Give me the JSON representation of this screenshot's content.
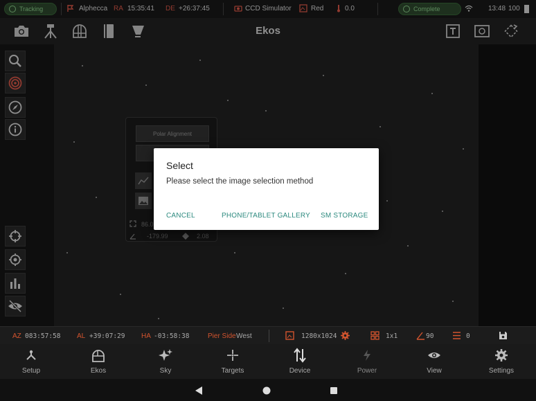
{
  "status_bar": {
    "tracking_label": "Tracking",
    "target_name": "Alphecca",
    "ra_label": "RA",
    "ra_value": "15:35:41",
    "de_label": "DE",
    "de_value": "+26:37:45",
    "camera_name": "CCD Simulator",
    "filter_name": "Red",
    "temperature": "0.0",
    "capture_status": "Complete",
    "clock": "13:48",
    "battery": "100"
  },
  "toolbar": {
    "title": "Ekos"
  },
  "polar_panel": {
    "button_label": "Polar Alignment",
    "value1": "86.0",
    "value2": "-179.99",
    "value3": "2.08"
  },
  "dialog": {
    "title": "Select",
    "message": "Please select the image selection method",
    "cancel_label": "CANCEL",
    "gallery_label": "PHONE/TABLET GALLERY",
    "storage_label": "SM STORAGE"
  },
  "info_bar": {
    "az_label": "AZ",
    "az_value": "083:57:58",
    "al_label": "AL",
    "al_value": "+39:07:29",
    "ha_label": "HA",
    "ha_value": "-03:58:38",
    "pier_label": "Pier Side",
    "pier_value": "West",
    "resolution": "1280x1024",
    "binning": "1x1",
    "rotation": "90",
    "exposure_count": "0"
  },
  "bottom_nav": {
    "items": [
      {
        "label": "Setup"
      },
      {
        "label": "Ekos"
      },
      {
        "label": "Sky"
      },
      {
        "label": "Targets"
      },
      {
        "label": "Device"
      },
      {
        "label": "Power"
      },
      {
        "label": "View"
      },
      {
        "label": "Settings"
      }
    ]
  },
  "colors": {
    "accent_red": "#e05a4a",
    "dialog_button": "#2d8a7f",
    "status_green": "#8fd48f"
  }
}
